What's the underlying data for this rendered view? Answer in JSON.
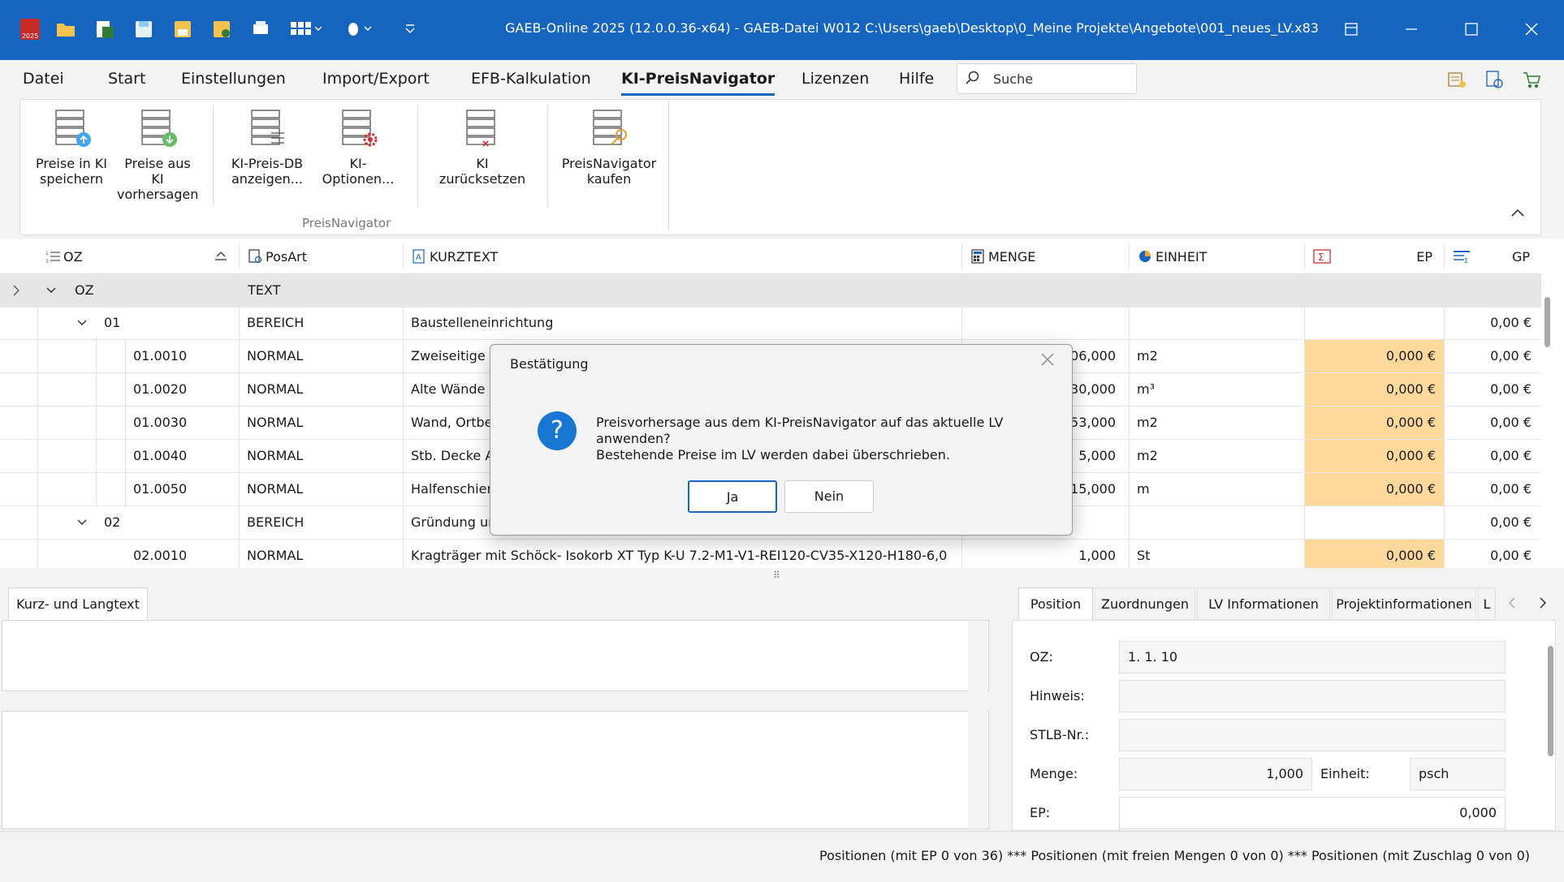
{
  "window": {
    "title": "GAEB-Online 2025 (12.0.0.36-x64) - GAEB-Datei  W012 C:\\Users\\gaeb\\Desktop\\0_Meine Projekte\\Angebote\\001_neues_LV.x83",
    "app_badge": "2025"
  },
  "menu": {
    "items": [
      "Datei",
      "Start",
      "Einstellungen",
      "Import/Export",
      "EFB-Kalkulation",
      "KI-PreisNavigator",
      "Lizenzen",
      "Hilfe"
    ],
    "active": "KI-PreisNavigator",
    "search_label": "Suche"
  },
  "ribbon": {
    "buttons": [
      {
        "line1": "Preise in KI",
        "line2": "speichern"
      },
      {
        "line1": "Preise aus KI",
        "line2": "vorhersagen"
      },
      {
        "line1": "KI-Preis-DB",
        "line2": "anzeigen..."
      },
      {
        "line1": "KI-Optionen...",
        "line2": ""
      },
      {
        "line1": "KI zurücksetzen",
        "line2": ""
      },
      {
        "line1": "PreisNavigator",
        "line2": "kaufen"
      }
    ],
    "group_label": "PreisNavigator"
  },
  "grid": {
    "headers": {
      "oz": "OZ",
      "posart": "PosArt",
      "kurztext": "KURZTEXT",
      "menge": "MENGE",
      "einheit": "EINHEIT",
      "ep": "EP",
      "gp": "GP"
    },
    "root": {
      "oz": "OZ",
      "posart": "TEXT"
    },
    "rows": [
      {
        "oz": "01",
        "posart": "BEREICH",
        "kurztext": "Baustelleneinrichtung",
        "menge": "",
        "einheit": "",
        "ep": "",
        "gp": "0,00 €"
      },
      {
        "oz": "01.0010",
        "posart": "NORMAL",
        "kurztext": "Zweiseitige Sc",
        "menge": "106,000",
        "einheit": "m2",
        "ep": "0,000 €",
        "gp": "0,00 €"
      },
      {
        "oz": "01.0020",
        "posart": "NORMAL",
        "kurztext": "Alte Wände ab",
        "menge": "30,000",
        "einheit": "m³",
        "ep": "0,000 €",
        "gp": "0,00 €"
      },
      {
        "oz": "01.0030",
        "posart": "NORMAL",
        "kurztext": "Wand, Ortbeto",
        "menge": "53,000",
        "einheit": "m2",
        "ep": "0,000 €",
        "gp": "0,00 €"
      },
      {
        "oz": "01.0040",
        "posart": "NORMAL",
        "kurztext": "Stb. Decke Au",
        "menge": "5,000",
        "einheit": "m2",
        "ep": "0,000 €",
        "gp": "0,00 €"
      },
      {
        "oz": "01.0050",
        "posart": "NORMAL",
        "kurztext": "Halfenschiener",
        "menge": "15,000",
        "einheit": "m",
        "ep": "0,000 €",
        "gp": "0,00 €"
      },
      {
        "oz": "02",
        "posart": "BEREICH",
        "kurztext": "Gründung und",
        "menge": "",
        "einheit": "",
        "ep": "",
        "gp": "0,00 €"
      },
      {
        "oz": "02.0010",
        "posart": "NORMAL",
        "kurztext": "Kragträger mit Schöck- Isokorb XT Typ K-U 7.2-M1-V1-REI120-CV35-X120-H180-6,0",
        "menge": "1,000",
        "einheit": "St",
        "ep": "0,000 €",
        "gp": "0,00 €"
      }
    ]
  },
  "bottom": {
    "left_tab": "Kurz- und Langtext",
    "right_tabs": [
      "Position",
      "Zuordnungen",
      "LV Informationen",
      "Projektinformationen",
      "L"
    ],
    "fields": {
      "oz_label": "OZ:",
      "oz_value": "1.  1.  10",
      "hinweis_label": "Hinweis:",
      "stlb_label": "STLB-Nr.:",
      "menge_label": "Menge:",
      "menge_value": "1,000",
      "einheit_label": "Einheit:",
      "einheit_value": "psch",
      "ep_label": "EP:",
      "ep_value": "0,000"
    }
  },
  "status": "Positionen (mit EP 0 von 36) *** Positionen (mit freien Mengen 0 von 0) *** Positionen (mit Zuschlag 0 von 0)",
  "dialog": {
    "title": "Bestätigung",
    "line1": "Preisvorhersage aus dem KI-PreisNavigator auf das aktuelle LV anwenden?",
    "line2": "Bestehende Preise im LV werden dabei überschrieben.",
    "yes": "Ja",
    "no": "Nein"
  },
  "colors": {
    "titlebar": "#1565c0",
    "ep_highlight": "#ffd89b",
    "accent": "#1565c0"
  }
}
